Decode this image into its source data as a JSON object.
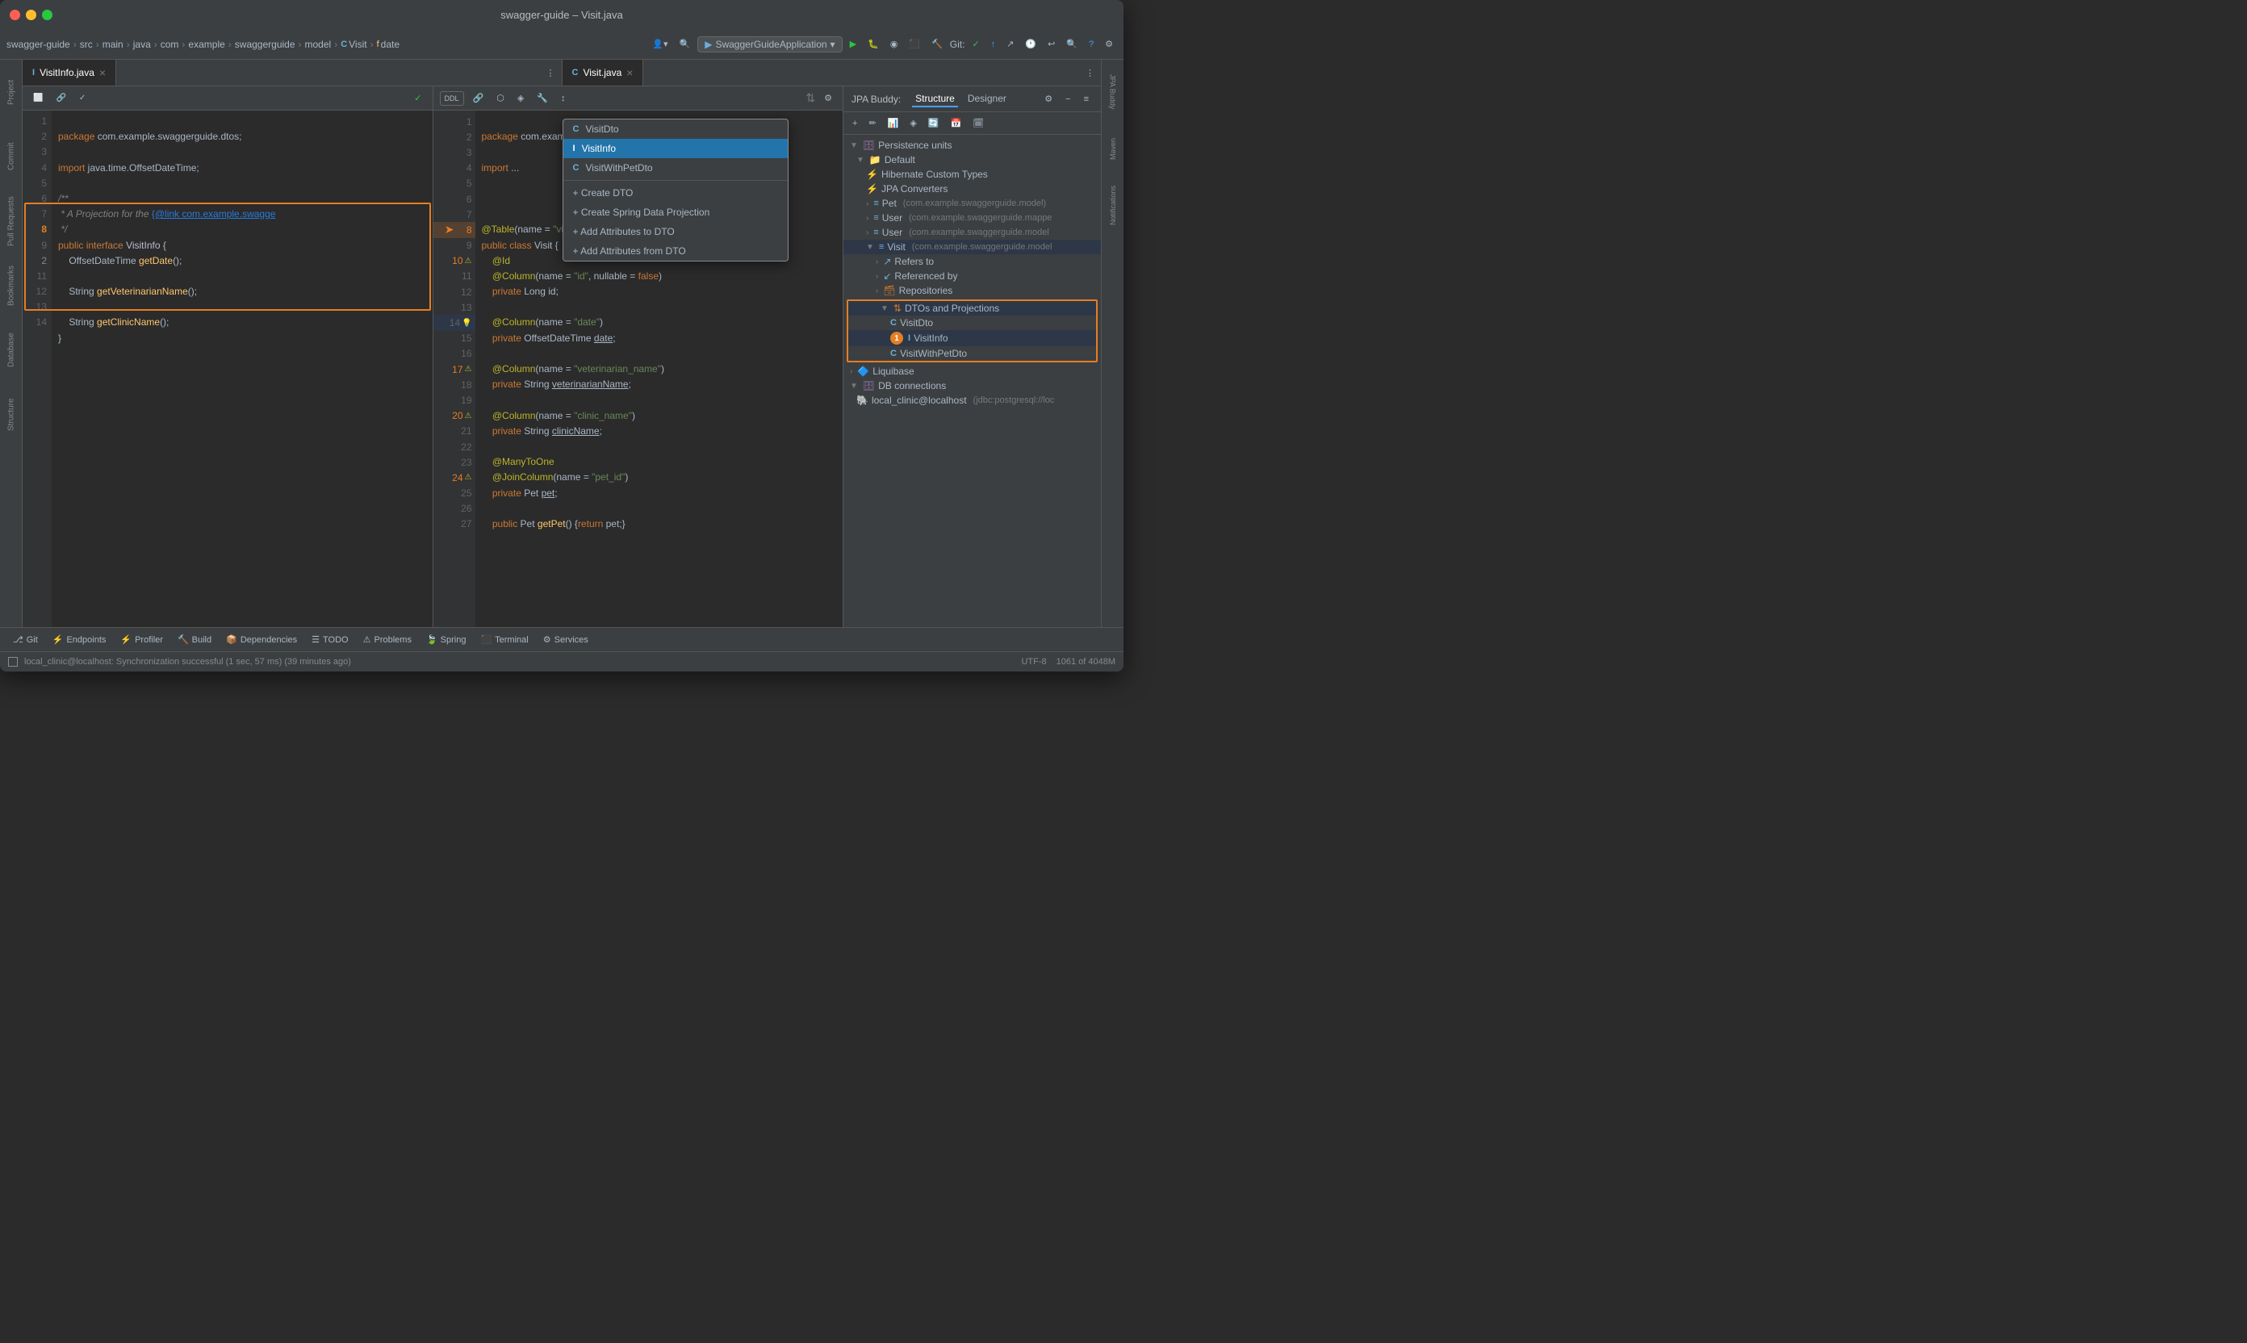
{
  "window": {
    "title": "swagger-guide – Visit.java",
    "traffic_lights": [
      "close",
      "minimize",
      "maximize"
    ]
  },
  "toolbar": {
    "breadcrumb": [
      "swagger-guide",
      "src",
      "main",
      "java",
      "com",
      "example",
      "swaggerguide",
      "model",
      "Visit",
      "date"
    ],
    "run_config": "SwaggerGuideApplication",
    "git_label": "Git:"
  },
  "left_editor": {
    "tab_label": "VisitInfo.java",
    "tab_icon": "I",
    "lines": [
      {
        "num": 1,
        "text": "package com.example.swaggerguide.dtos;"
      },
      {
        "num": 2,
        "text": ""
      },
      {
        "num": 3,
        "text": "import java.time.OffsetDateTime;"
      },
      {
        "num": 4,
        "text": ""
      },
      {
        "num": 5,
        "text": "/**"
      },
      {
        "num": 6,
        "text": " * A Projection for the {@link com.example.swagge"
      },
      {
        "num": 7,
        "text": " */"
      },
      {
        "num": 8,
        "text": "public interface VisitInfo {"
      },
      {
        "num": 9,
        "text": "    OffsetDateTime getDate();"
      },
      {
        "num": 10,
        "text": ""
      },
      {
        "num": 11,
        "text": "    String getVeterinarianName();"
      },
      {
        "num": 12,
        "text": ""
      },
      {
        "num": 13,
        "text": "    String getClinicName();"
      },
      {
        "num": 14,
        "text": "}"
      }
    ]
  },
  "right_editor": {
    "tab_label": "Visit.java",
    "tab_icon": "C",
    "lines": [
      {
        "num": 1,
        "text": "package com.example."
      },
      {
        "num": 2,
        "text": ""
      },
      {
        "num": 3,
        "text": "import ..."
      },
      {
        "num": 4,
        "text": ""
      },
      {
        "num": 5,
        "text": ""
      },
      {
        "num": 6,
        "text": ""
      },
      {
        "num": 7,
        "text": "@Table(name = \"visit\""
      },
      {
        "num": 8,
        "text": "public class Visit {"
      },
      {
        "num": 9,
        "text": "    @Id"
      },
      {
        "num": 10,
        "text": "    @Column(name = \"id\", nullable = false)"
      },
      {
        "num": 11,
        "text": "    private Long id;"
      },
      {
        "num": 12,
        "text": ""
      },
      {
        "num": 13,
        "text": "    @Column(name = \"date\")"
      },
      {
        "num": 14,
        "text": "    private OffsetDateTime date;"
      },
      {
        "num": 15,
        "text": ""
      },
      {
        "num": 16,
        "text": "    @Column(name = \"veterinarian_name\")"
      },
      {
        "num": 17,
        "text": "    private String veterinarianName;"
      },
      {
        "num": 18,
        "text": ""
      },
      {
        "num": 19,
        "text": "    @Column(name = \"clinic_name\")"
      },
      {
        "num": 20,
        "text": "    private String clinicName;"
      },
      {
        "num": 21,
        "text": ""
      },
      {
        "num": 22,
        "text": "    @ManyToOne"
      },
      {
        "num": 23,
        "text": "    @JoinColumn(name = \"pet_id\")"
      },
      {
        "num": 24,
        "text": "    private Pet pet;"
      },
      {
        "num": 25,
        "text": ""
      },
      {
        "num": 26,
        "text": "    public Pet getPet() {return pet;}"
      },
      {
        "num": 27,
        "text": ""
      }
    ]
  },
  "dropdown": {
    "items": [
      {
        "label": "VisitDto",
        "icon": "C",
        "type": "class"
      },
      {
        "label": "VisitInfo",
        "icon": "I",
        "type": "interface",
        "selected": true
      },
      {
        "label": "VisitWithPetDto",
        "icon": "C",
        "type": "class"
      }
    ],
    "actions": [
      {
        "label": "+ Create DTO"
      },
      {
        "label": "+ Create Spring Data Projection"
      },
      {
        "label": "+ Add Attributes to DTO"
      },
      {
        "label": "+ Add Attributes from DTO"
      }
    ]
  },
  "jpa_panel": {
    "title": "JPA Buddy:",
    "tabs": [
      "Structure",
      "Designer"
    ],
    "active_tab": "Structure",
    "tree": {
      "root": "Persistence units",
      "items": [
        {
          "label": "Default",
          "level": 1,
          "expanded": true,
          "icon": "folder"
        },
        {
          "label": "Hibernate Custom Types",
          "level": 2,
          "icon": "hibernate"
        },
        {
          "label": "JPA Converters",
          "level": 2,
          "icon": "converters"
        },
        {
          "label": "Pet",
          "level": 2,
          "icon": "class",
          "detail": "(com.example.swaggerguide.model)"
        },
        {
          "label": "User",
          "level": 2,
          "icon": "class",
          "detail": "(com.example.swaggerguide.mappe"
        },
        {
          "label": "User",
          "level": 2,
          "icon": "class",
          "detail": "(com.example.swaggerguide.model"
        },
        {
          "label": "Visit",
          "level": 2,
          "icon": "class",
          "detail": "(com.example.swaggerguide.model",
          "expanded": true
        },
        {
          "label": "Refers to",
          "level": 3,
          "icon": "arrow"
        },
        {
          "label": "Referenced by",
          "level": 3,
          "icon": "arrow"
        },
        {
          "label": "Repositories",
          "level": 3,
          "icon": "repo"
        },
        {
          "label": "DTOs and Projections",
          "level": 3,
          "icon": "dto",
          "expanded": true,
          "highlighted": true
        },
        {
          "label": "VisitDto",
          "level": 4,
          "icon": "C"
        },
        {
          "label": "VisitInfo",
          "level": 4,
          "icon": "I",
          "badge": "1"
        },
        {
          "label": "VisitWithPetDto",
          "level": 4,
          "icon": "C"
        }
      ]
    }
  },
  "bottom_tabs": [
    {
      "label": "Git",
      "icon": "git"
    },
    {
      "label": "Endpoints",
      "icon": "endpoints"
    },
    {
      "label": "Profiler",
      "icon": "profiler"
    },
    {
      "label": "Build",
      "icon": "build"
    },
    {
      "label": "Dependencies",
      "icon": "deps"
    },
    {
      "label": "TODO",
      "icon": "todo"
    },
    {
      "label": "Problems",
      "icon": "problems"
    },
    {
      "label": "Spring",
      "icon": "spring"
    },
    {
      "label": "Terminal",
      "icon": "terminal"
    },
    {
      "label": "Services",
      "icon": "services"
    }
  ],
  "status_bar": {
    "left": "local_clinic@localhost: Synchronization successful (1 sec, 57 ms) (39 minutes ago)",
    "encoding": "UTF-8",
    "line_info": "1061 of 4048M"
  },
  "sidebar_tabs": [
    "Project",
    "Commit",
    "Pull Requests",
    "Bookmarks",
    "Database",
    "Structure"
  ],
  "right_sidebar_tabs": [
    "JPA Buddy",
    "Maven",
    "Notifications"
  ]
}
